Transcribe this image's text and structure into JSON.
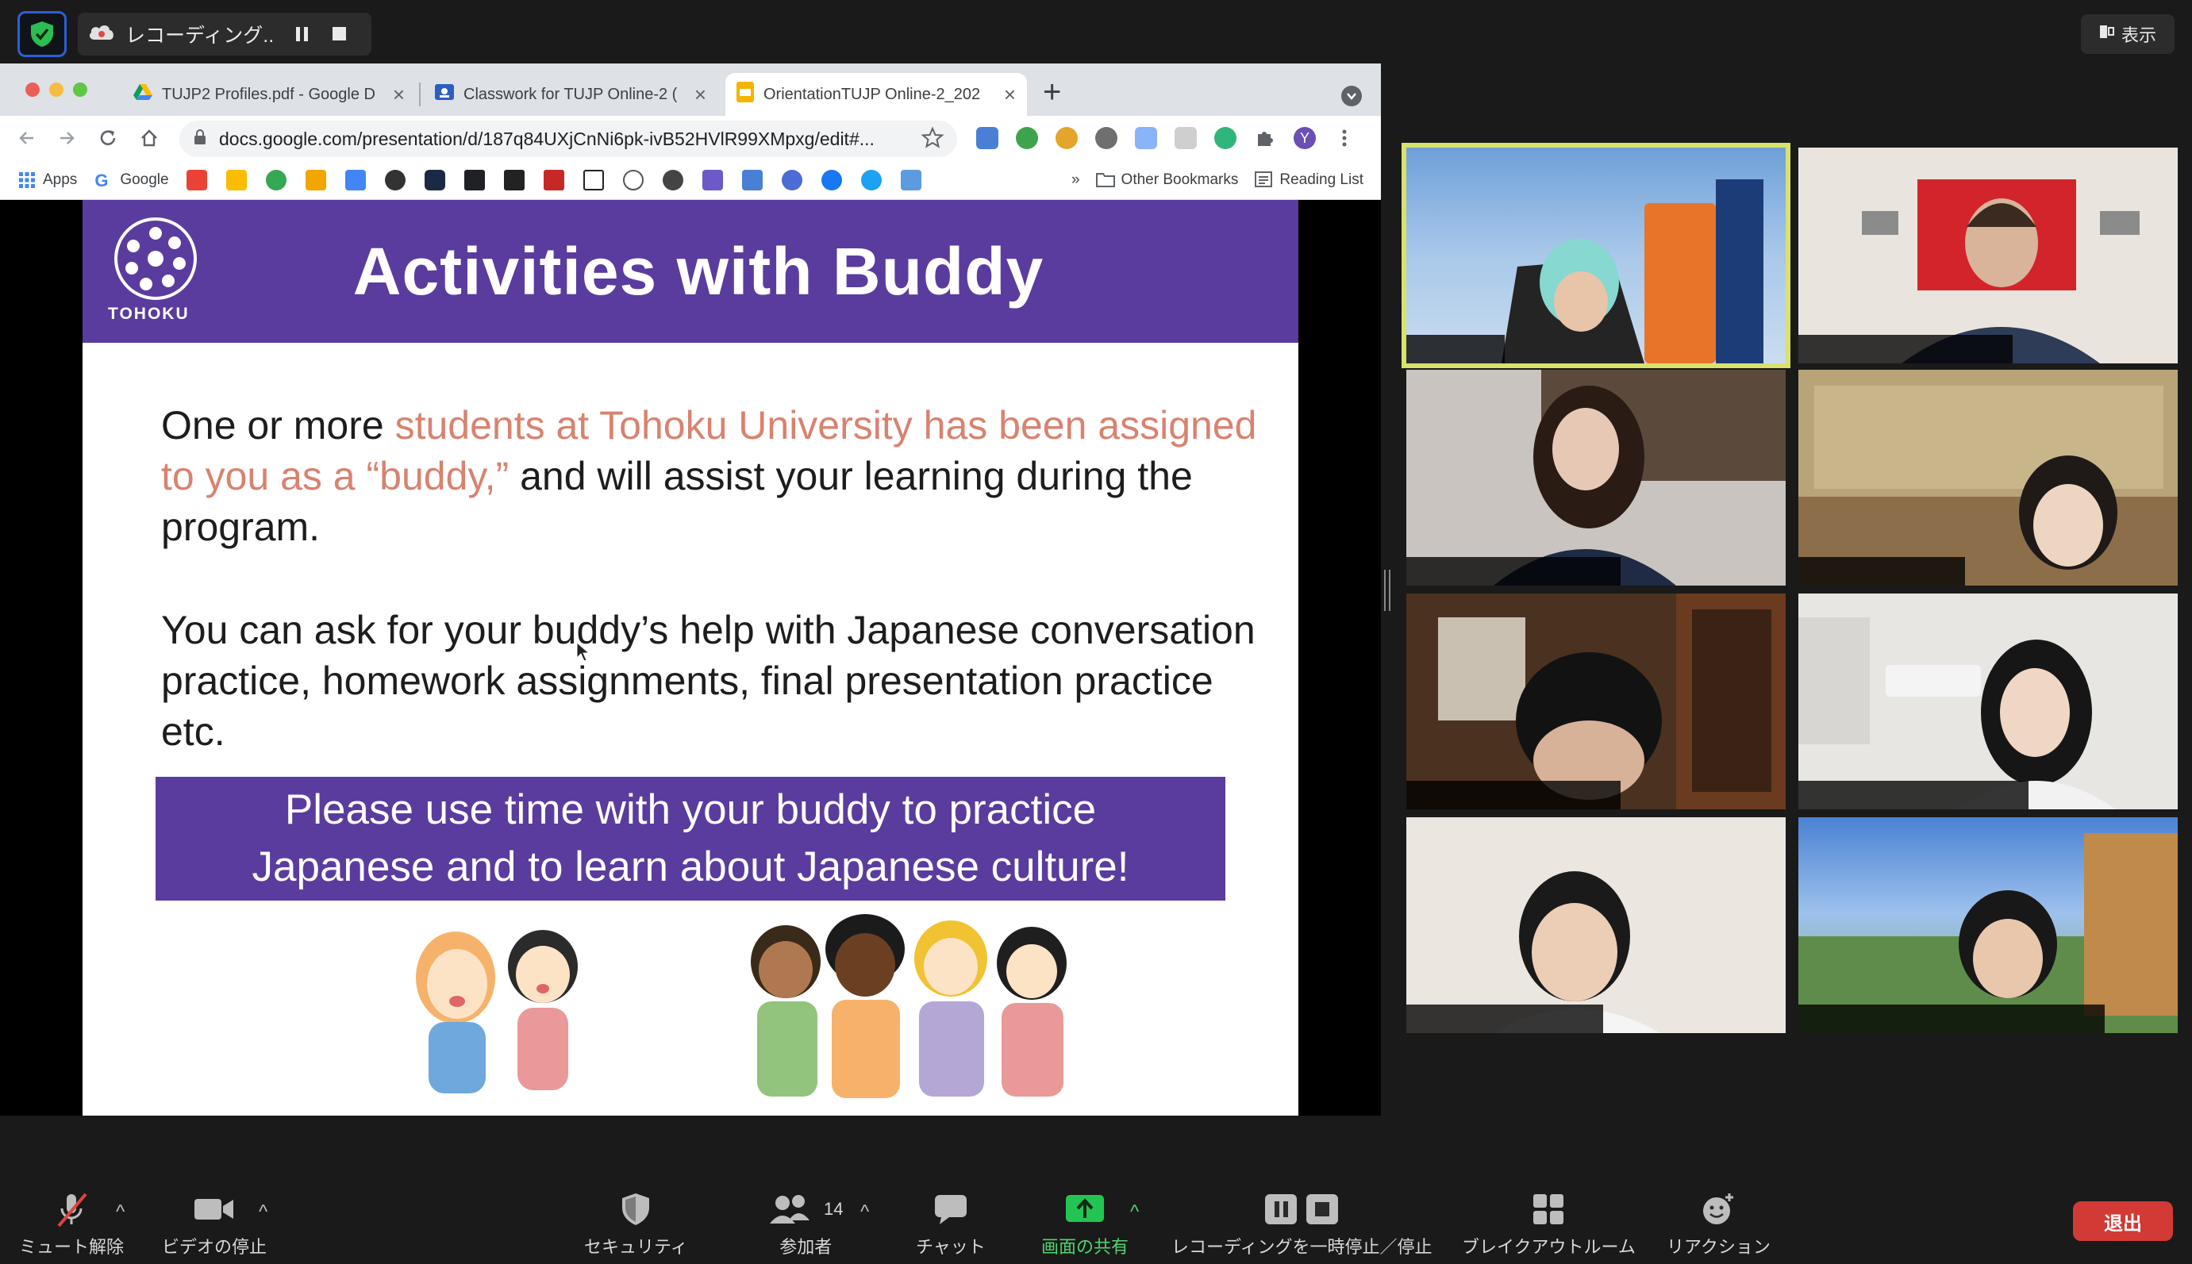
{
  "zoom_top": {
    "recording_label": "レコーディング...",
    "view_label": "表示"
  },
  "browser": {
    "tabs": [
      {
        "title": "TUJP2 Profiles.pdf - Google D",
        "active": false
      },
      {
        "title": "Classwork for TUJP Online-2 (",
        "active": false
      },
      {
        "title": "OrientationTUJP Online-2_202",
        "active": true
      }
    ],
    "url": "docs.google.com/presentation/d/187q84UXjCnNi6pk-ivB52HVlR99XMpxg/edit#...",
    "profile_initial": "Y",
    "bookmarks": {
      "apps": "Apps",
      "google": "Google",
      "other": "Other Bookmarks",
      "reading_list": "Reading List",
      "overflow": "»"
    }
  },
  "slide": {
    "logo_text": "TOHOKU",
    "title": "Activities with Buddy",
    "para1_a": "One or more ",
    "para1_hl": "students at Tohoku University has been assigned to you as a “buddy,”",
    "para1_b": " and will assist your learning during the program.",
    "para2": "You can ask for your buddy’s help with Japanese conversation practice, homework assignments, final presentation practice etc.",
    "callout_line1": "Please use time with your buddy to practice",
    "callout_line2": "Japanese and to learn about Japanese culture!"
  },
  "zoom_bottom": {
    "mute": "ミュート解除",
    "video": "ビデオの停止",
    "security": "セキュリティ",
    "participants": "参加者",
    "participant_count": "14",
    "chat": "チャット",
    "share": "画面の共有",
    "recording": "レコーディングを一時停止／停止",
    "breakout": "ブレイクアウトルーム",
    "reactions": "リアクション",
    "leave": "退出"
  },
  "colors": {
    "slide_purple": "#5a3c9e",
    "highlight": "#d9826f",
    "share_green": "#23c552",
    "leave_red": "#d23a35",
    "active_speaker": "#d9e26b"
  }
}
